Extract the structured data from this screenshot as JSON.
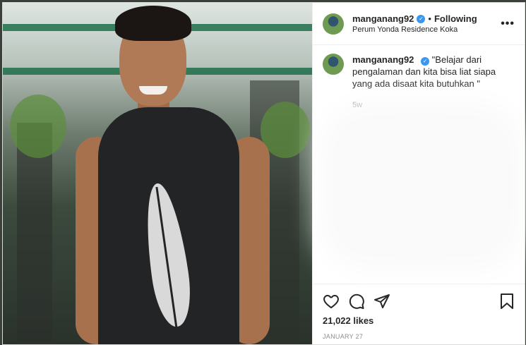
{
  "post": {
    "username": "manganang92",
    "follow_separator": "•",
    "follow_status": "Following",
    "location": "Perum Yonda Residence Koka",
    "more_label": "•••",
    "caption": "\"Belajar dari pengalaman dan kita bisa liat siapa yang ada disaat kita butuhkan \"",
    "time_ago": "5w",
    "likes": "21,022 likes",
    "date": "JANUARY 27"
  },
  "icons": {
    "verified": "verified-badge-icon",
    "like": "heart-icon",
    "comment": "comment-icon",
    "share": "share-icon",
    "save": "bookmark-icon",
    "more": "more-options-icon"
  },
  "colors": {
    "verified": "#3897f0",
    "muted_text": "#8e8e8e",
    "text": "#262626"
  }
}
